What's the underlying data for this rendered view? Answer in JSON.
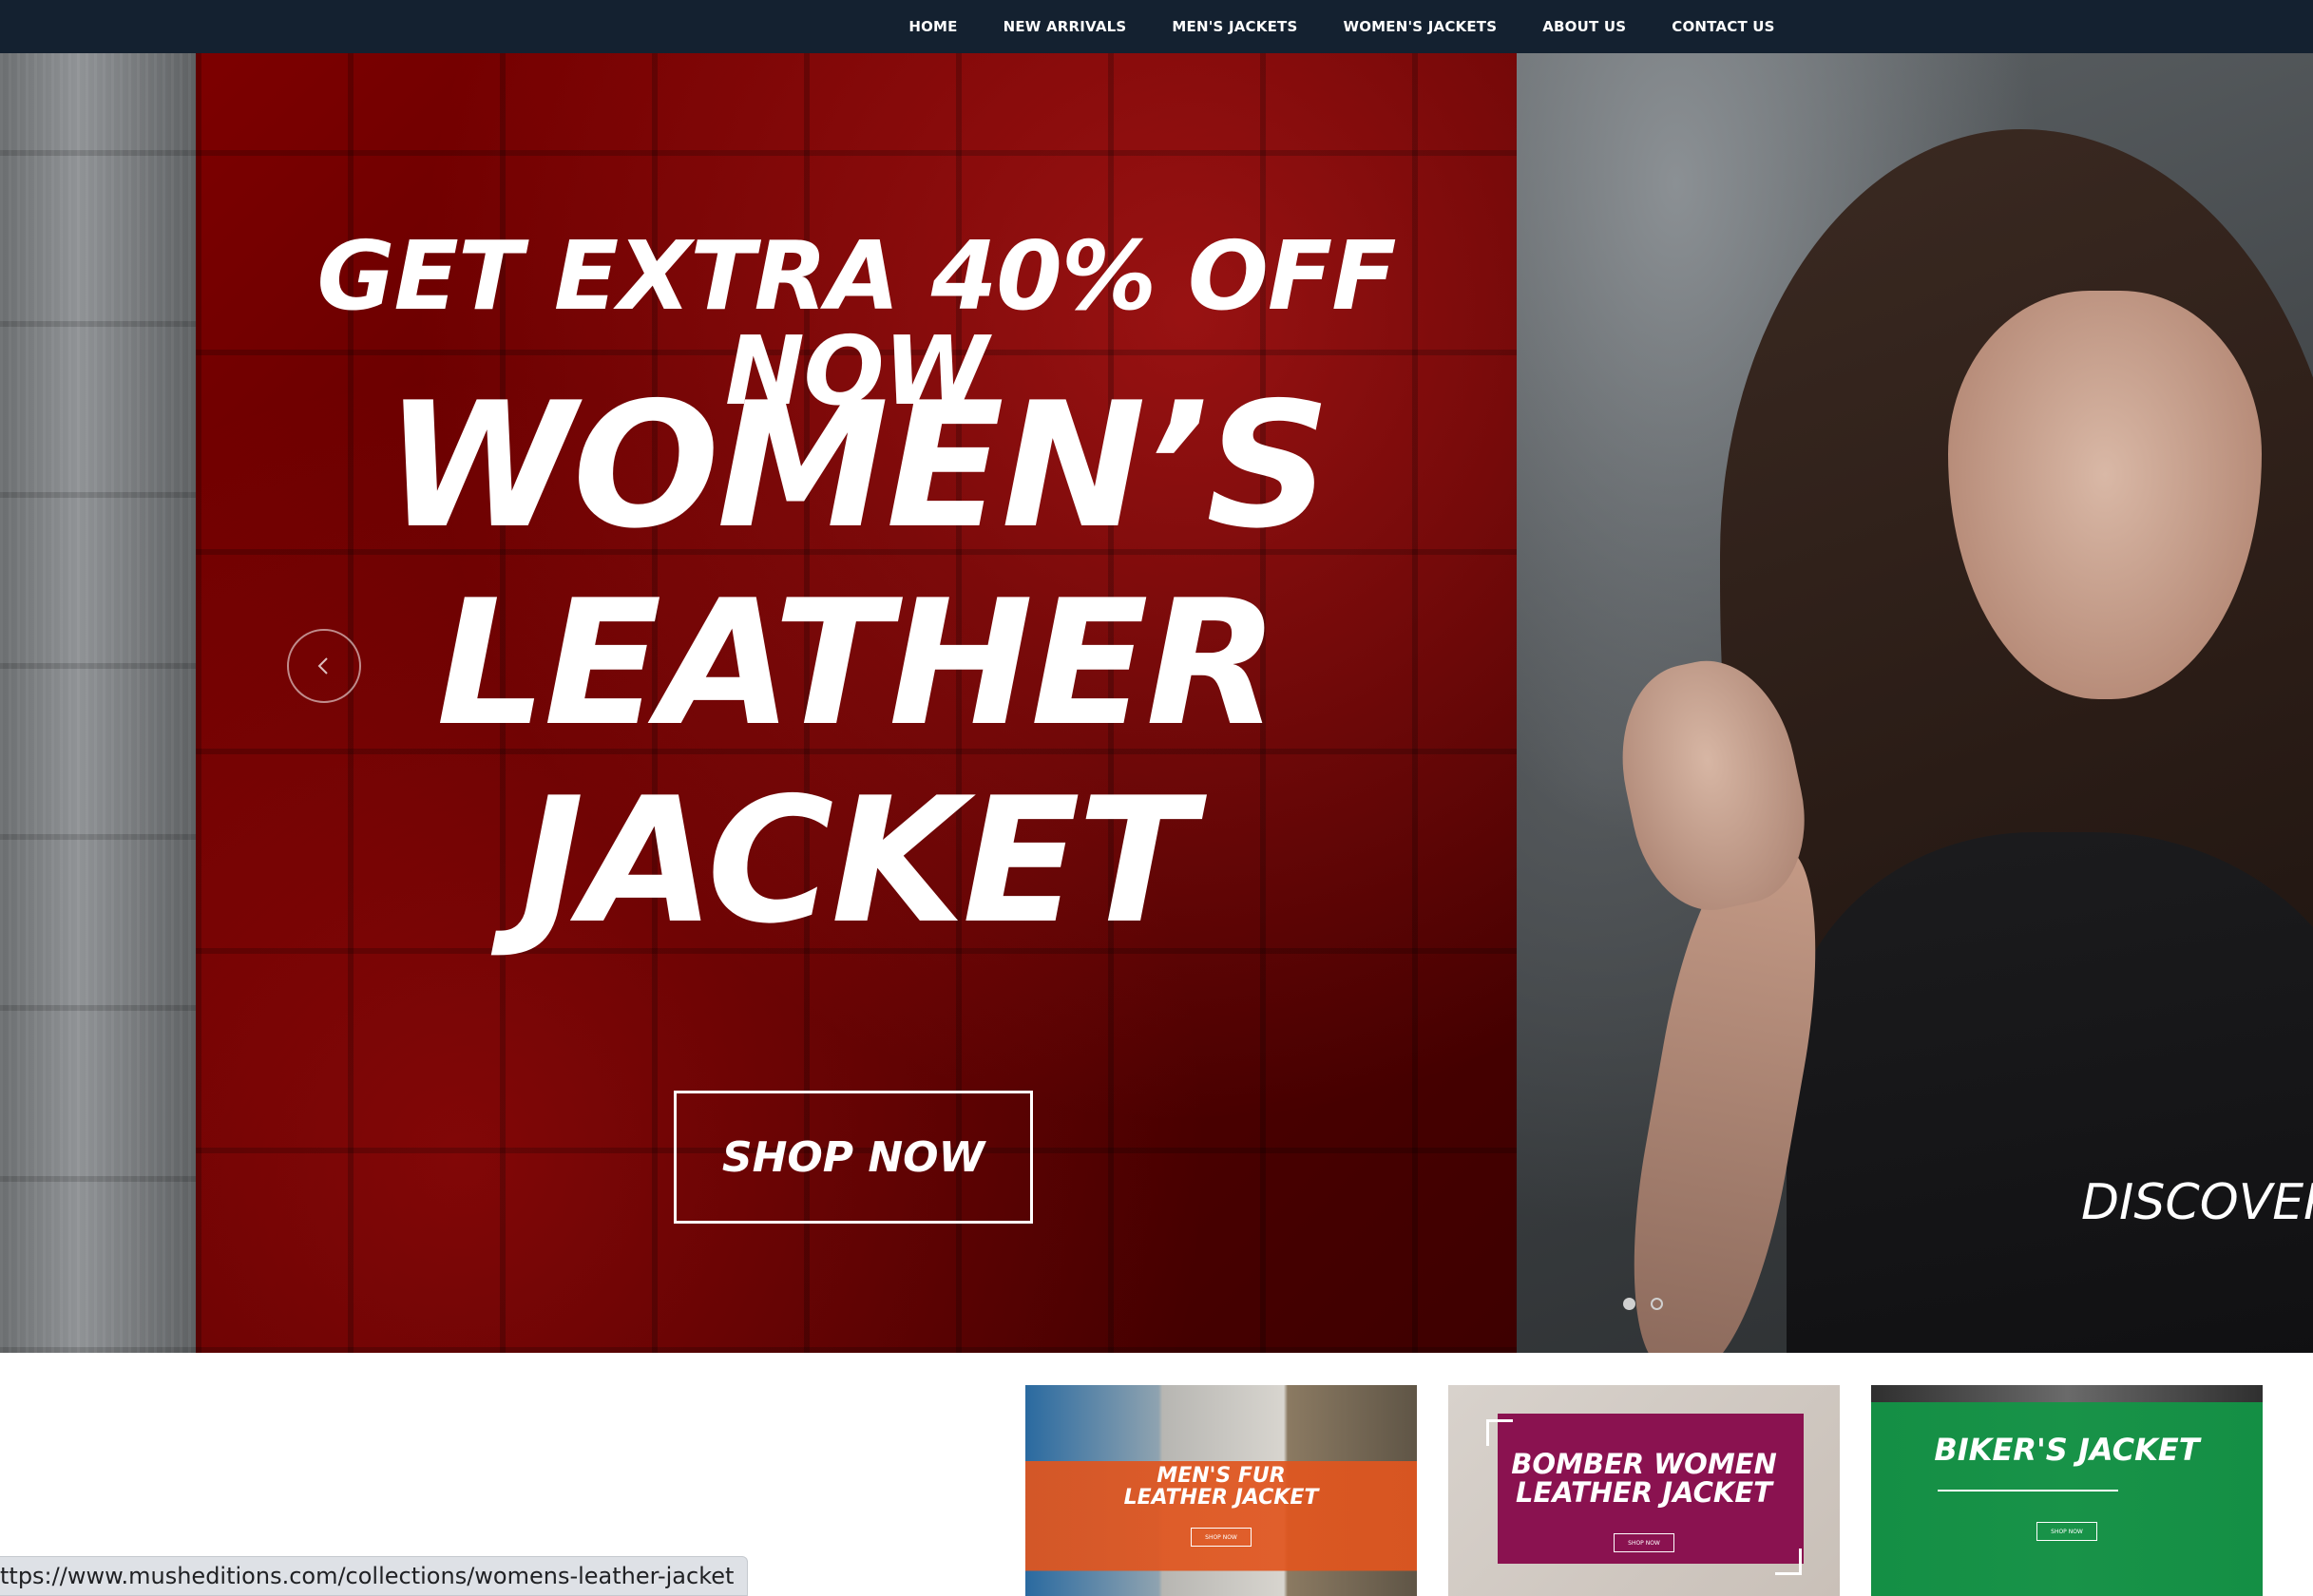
{
  "nav": {
    "items": [
      "HOME",
      "NEW ARRIVALS",
      "MEN'S JACKETS",
      "WOMEN'S JACKETS",
      "ABOUT US",
      "CONTACT US"
    ]
  },
  "hero": {
    "promo_top": "GET EXTRA 40% OFF NOW",
    "title_line1": "WOMEN’S",
    "title_line2": "LEATHER",
    "title_line3": "JACKET",
    "cta": "SHOP NOW",
    "next_slide_text": "DISCOVER",
    "slide_dots": {
      "count": 2,
      "active_index": 0
    },
    "icons": {
      "prev": "chevron-left-icon"
    }
  },
  "tiles": [
    {
      "label_line1": "MEN'S FUR",
      "label_line2": "LEATHER JACKET",
      "button": "SHOP NOW"
    },
    {
      "label_line1": "BOMBER WOMEN",
      "label_line2": "LEATHER JACKET",
      "button": "SHOP NOW"
    },
    {
      "label_line1": "BIKER'S JACKET",
      "label_line2": "",
      "button": "SHOP NOW"
    }
  ],
  "status_bar": {
    "url": "ttps://www.musheditions.com/collections/womens-leather-jacket"
  },
  "colors": {
    "nav_bg": "#142130",
    "hero_panel": "#6a0000",
    "tile_orange": "#e1551e",
    "tile_magenta": "#8a1250",
    "tile_green": "#129646"
  }
}
